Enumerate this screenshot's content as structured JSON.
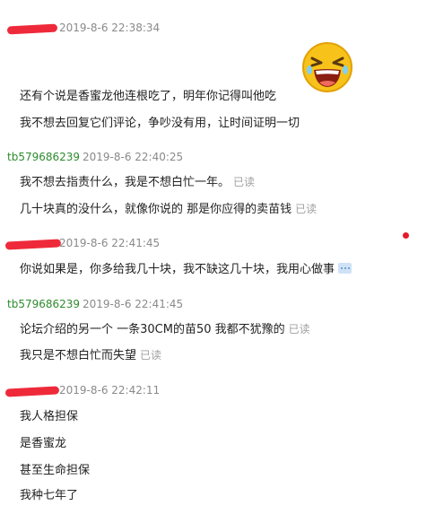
{
  "messages": [
    {
      "sender": "",
      "time": "2019-8-6 22:38:34",
      "lines": [
        {
          "text": "还有个说是香蜜龙他连根吃了，明年你记得叫他吃",
          "status": ""
        },
        {
          "text": "我不想去回复它们评论，争吵没有用，让时间证明一切",
          "status": ""
        }
      ]
    },
    {
      "sender": "tb579686239",
      "time": "2019-8-6 22:40:25",
      "lines": [
        {
          "text": "我不想去指责什么，我是不想白忙一年。",
          "status": "已读"
        },
        {
          "text": "几十块真的没什么，就像你说的 那是你应得的卖苗钱",
          "status": "已读"
        }
      ]
    },
    {
      "sender": "",
      "time": "2019-8-6 22:41:45",
      "lines": [
        {
          "text": "你说如果是，你多给我几十块，我不缺这几十块，我用心做事",
          "status": ""
        }
      ]
    },
    {
      "sender": "tb579686239",
      "time": "2019-8-6 22:41:45",
      "lines": [
        {
          "text": "论坛介绍的另一个 一条30CM的苗50 我都不犹豫的",
          "status": "已读"
        },
        {
          "text": "我只是不想白忙而失望",
          "status": "已读"
        }
      ]
    },
    {
      "sender": "",
      "time": "2019-8-6 22:42:11",
      "lines": [
        {
          "text": "我人格担保",
          "status": ""
        },
        {
          "text": "是香蜜龙",
          "status": ""
        },
        {
          "text": "甚至生命担保",
          "status": ""
        },
        {
          "text": "我种七年了",
          "status": ""
        }
      ]
    }
  ],
  "colors": {
    "sender_green": "#2e8b2e",
    "timestamp_gray": "#8a8a8a",
    "redaction_red": "#ee2a3a",
    "read_gray": "#a0a0a0"
  },
  "icons": [
    "laughing-emoji-icon",
    "more-dots-icon",
    "notification-dot-icon"
  ]
}
